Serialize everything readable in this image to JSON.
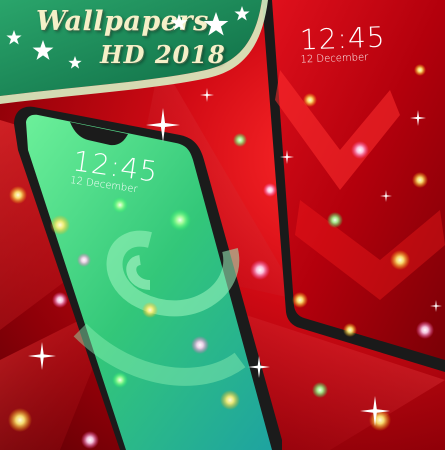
{
  "banner": {
    "line1": "Wallpapers",
    "line2": "HD 2018"
  },
  "phone_left": {
    "time": "12:45",
    "date": "12 December"
  },
  "phone_right": {
    "time": "12:45",
    "date": "12 December"
  },
  "colors": {
    "banner_green": "#1f8a5a",
    "background_red": "#c8000f",
    "wallpaper_green": "#3fd27a"
  }
}
